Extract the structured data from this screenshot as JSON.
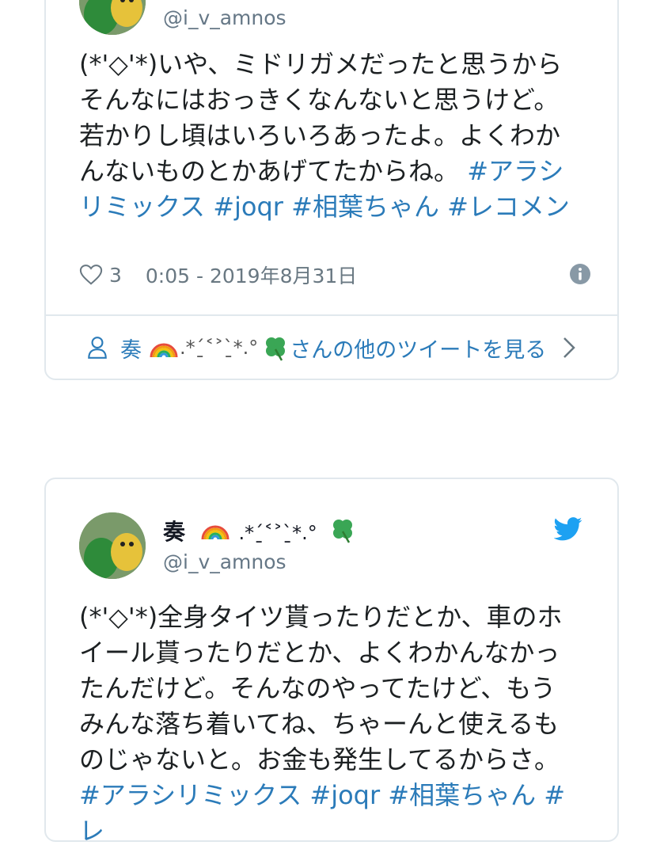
{
  "tweet1": {
    "handle": "@i_v_amnos",
    "lines": [
      "(*'◇'*)いや、ミドリガメだったと思うから",
      "そんなにはおっきくなんないと思うけど。",
      "若かりし頃はいろいろあったよ。よくわか"
    ],
    "line4_text": "んないものとかあげてたからね。",
    "line4_tag": "#アラシ",
    "line5_tag": "リミックス #joqr #相葉ちゃん #レコメン",
    "like_count": "3",
    "timestamp": "0:05 - 2019年8月31日",
    "more_name": "奏",
    "more_kaomoji": ".*ˊ̱˂˃ˋ̱*.°",
    "more_label": "さんの他のツイートを見る"
  },
  "tweet2": {
    "display_name": "奏",
    "kaomoji": ".*ˊ̱˂˃ˋ̱*.°",
    "handle": "@i_v_amnos",
    "lines": [
      "(*'◇'*)全身タイツ貰ったりだとか、車のホ",
      "イール貰ったりだとか、よくわかんなかっ",
      "たんだけど。そんなのやってたけど、もう",
      "みんな落ち着いてね、ちゃーんと使えるも",
      "のじゃないと。お金も発生してるからさ。"
    ],
    "tag_line": "#アラシリミックス #joqr #相葉ちゃん #レ"
  },
  "colors": {
    "link": "#2b7bb9",
    "muted": "#697882",
    "border": "#e1e8ed",
    "twitter_blue": "#1da1f2"
  },
  "icons": [
    "heart-icon",
    "info-icon",
    "user-icon",
    "chevron-right-icon",
    "twitter-bird-icon",
    "rainbow-emoji",
    "clover-emoji"
  ]
}
